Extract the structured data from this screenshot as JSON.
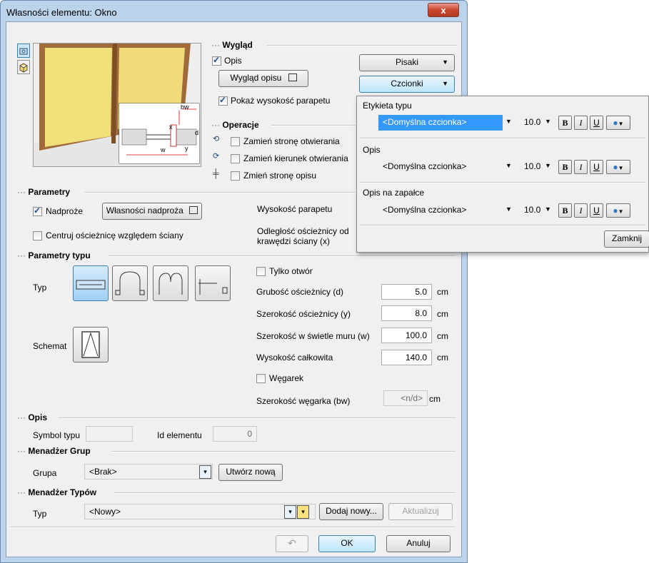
{
  "window": {
    "title": "Własności elementu: Okno",
    "close": "x"
  },
  "wyglad": {
    "section": "Wygląd",
    "opis_label": "Opis",
    "opis_checked": true,
    "wyglad_opisu_button": "Wygląd opisu",
    "pokaz_label": "Pokaż wysokość parapetu",
    "pokaz_checked": true,
    "pisaki_button": "Pisaki",
    "czcionki_button": "Czcionki"
  },
  "preview": {
    "bw": "bw",
    "x": "x",
    "d": "d",
    "w": "w",
    "y": "y"
  },
  "operacje": {
    "section": "Operacje",
    "items": [
      "Zamień stronę otwierania",
      "Zamień kierunek otwierania",
      "Zmień stronę opisu"
    ]
  },
  "parametry": {
    "section": "Parametry",
    "nadproze_label": "Nadproże",
    "nadproze_checked": true,
    "wlasnosci_nadproza_button": "Własności nadproża",
    "centruj_label": "Centruj ościeżnicę względem ściany",
    "wysokosc_parapetu_label": "Wysokość parapetu",
    "odleglosc_label_1": "Odległość ościeżnicy od",
    "odleglosc_label_2": "krawędzi ściany (x)"
  },
  "parametry_typu": {
    "section": "Parametry typu",
    "typ_label": "Typ",
    "schemat_label": "Schemat",
    "tylko_otwor_label": "Tylko otwór",
    "rows": [
      {
        "label": "Grubość ościeżnicy (d)",
        "value": "5.0",
        "unit": "cm"
      },
      {
        "label": "Szerokość ościeżnicy (y)",
        "value": "8.0",
        "unit": "cm"
      },
      {
        "label": "Szerokość w świetle muru (w)",
        "value": "100.0",
        "unit": "cm"
      },
      {
        "label": "Wysokość całkowita",
        "value": "140.0",
        "unit": "cm"
      }
    ],
    "wegarek_label": "Węgarek",
    "szer_wegarka_label": "Szerokość węgarka (bw)",
    "szer_wegarka_value": "<n/d>",
    "szer_wegarka_unit": "cm"
  },
  "opis": {
    "section": "Opis",
    "symbol_typu_label": "Symbol typu",
    "symbol_typu_value": "",
    "id_elementu_label": "Id elementu",
    "id_elementu_value": "0"
  },
  "grupy": {
    "section": "Menadżer Grup",
    "grupa_label": "Grupa",
    "grupa_value": "<Brak>",
    "utworz_button": "Utwórz nową"
  },
  "typy": {
    "section": "Menadżer Typów",
    "typ_label": "Typ",
    "typ_value": "<Nowy>",
    "dodaj_button": "Dodaj nowy...",
    "aktualizuj_button": "Aktualizuj"
  },
  "footer": {
    "ok": "OK",
    "anuluj": "Anuluj",
    "undo_icon": "undo-icon"
  },
  "font_popup": {
    "rows": [
      {
        "title": "Etykieta typu",
        "font": "<Domyślna czcionka>",
        "size": "10.0",
        "highlighted": true
      },
      {
        "title": "Opis",
        "font": "<Domyślna czcionka>",
        "size": "10.0",
        "highlighted": false
      },
      {
        "title": "Opis na zapałce",
        "font": "<Domyślna czcionka>",
        "size": "10.0",
        "highlighted": false
      }
    ],
    "bold": "B",
    "italic": "I",
    "underline": "U",
    "close_button": "Zamknij"
  },
  "colors": {
    "accent": "#3399ff",
    "window_frame": "#bcd3ec",
    "close_red": "#c8462f"
  }
}
